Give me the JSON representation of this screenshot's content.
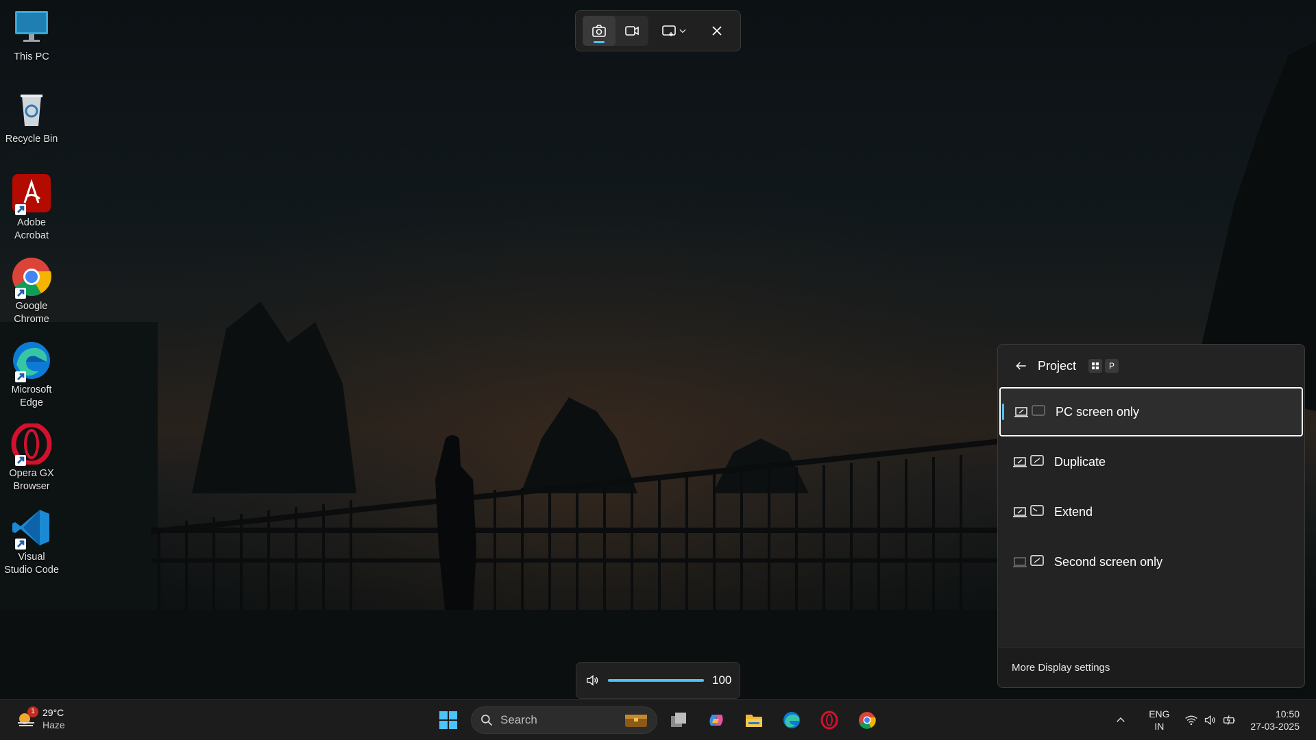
{
  "desktop": {
    "icons": [
      {
        "label": "This PC",
        "icon": "monitor-icon"
      },
      {
        "label": "Recycle Bin",
        "icon": "recycle-bin-icon"
      },
      {
        "label": "Adobe Acrobat",
        "icon": "adobe-acrobat-icon"
      },
      {
        "label": "Google Chrome",
        "icon": "chrome-icon"
      },
      {
        "label": "Microsoft Edge",
        "icon": "edge-icon"
      },
      {
        "label": "Opera GX Browser",
        "icon": "opera-icon"
      },
      {
        "label": "Visual Studio Code",
        "icon": "vscode-icon"
      }
    ]
  },
  "snip_toolbar": {
    "modes": [
      "camera-icon",
      "video-icon"
    ],
    "shape": "rectangle-select-icon",
    "close": "close-icon",
    "active_mode": "screenshot"
  },
  "volume": {
    "value": "100",
    "level": 1.0
  },
  "project": {
    "title": "Project",
    "shortcut_key": "P",
    "options": [
      {
        "label": "PC screen only",
        "selected": true
      },
      {
        "label": "Duplicate",
        "selected": false
      },
      {
        "label": "Extend",
        "selected": false
      },
      {
        "label": "Second screen only",
        "selected": false
      }
    ],
    "footer": "More Display settings"
  },
  "taskbar": {
    "weather": {
      "temp": "29°C",
      "condition": "Haze",
      "badge": "1"
    },
    "search_placeholder": "Search",
    "language": {
      "line1": "ENG",
      "line2": "IN"
    },
    "clock": {
      "time": "10:50",
      "date": "27-03-2025"
    }
  },
  "colors": {
    "accent": "#4cc2ff",
    "panel": "#232323",
    "taskbar": "#1c1c1c"
  }
}
